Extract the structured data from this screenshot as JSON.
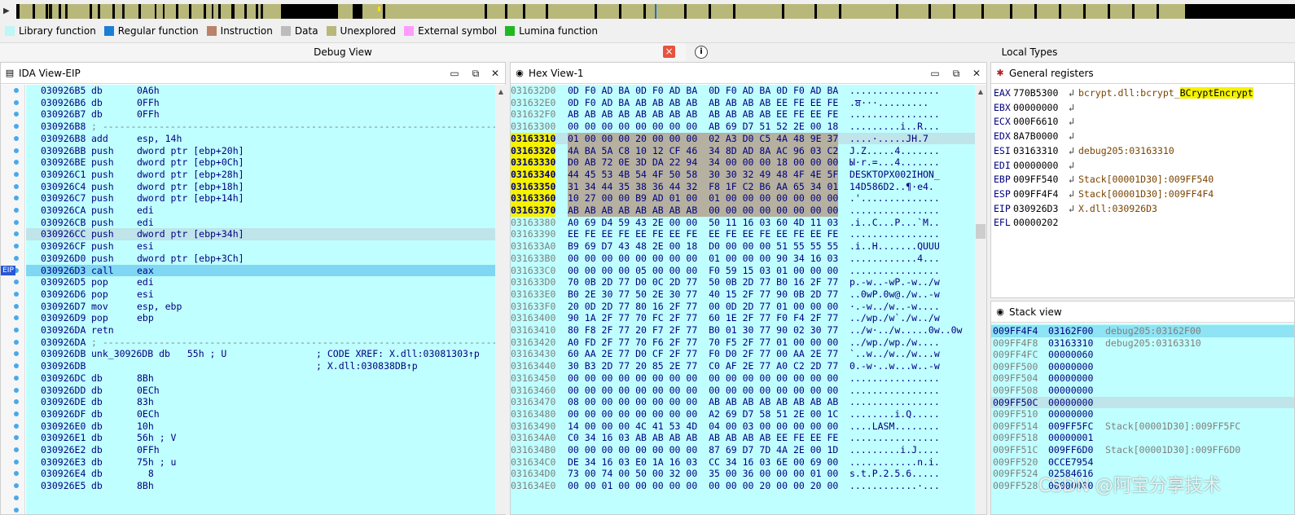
{
  "legend": [
    {
      "label": "Library function",
      "color": "#bff6f6"
    },
    {
      "label": "Regular function",
      "color": "#1a7fd4"
    },
    {
      "label": "Instruction",
      "color": "#b9826a"
    },
    {
      "label": "Data",
      "color": "#bcbcbc"
    },
    {
      "label": "Unexplored",
      "color": "#b8b87a"
    },
    {
      "label": "External symbol",
      "color": "#ff9cff"
    },
    {
      "label": "Lumina function",
      "color": "#22b822"
    }
  ],
  "tabs": {
    "debug_view": "Debug View",
    "local_types": "Local Types"
  },
  "ida": {
    "title": "IDA View-EIP",
    "eip_flag": "EIP",
    "lines": [
      {
        "addr": "030926B5",
        "mn": "db",
        "op": "0A6h"
      },
      {
        "addr": "030926B6",
        "mn": "db",
        "op": "0FFh"
      },
      {
        "addr": "030926B7",
        "mn": "db",
        "op": "0FFh"
      },
      {
        "addr": "030926B8",
        "mn": "; -------------------------------------------------------------------------",
        "op": ""
      },
      {
        "addr": "030926B8",
        "mn": "add",
        "op": "esp, 14h"
      },
      {
        "addr": "030926BB",
        "mn": "push",
        "op": "dword ptr [ebp+20h]"
      },
      {
        "addr": "030926BE",
        "mn": "push",
        "op": "dword ptr [ebp+0Ch]"
      },
      {
        "addr": "030926C1",
        "mn": "push",
        "op": "dword ptr [ebp+28h]"
      },
      {
        "addr": "030926C4",
        "mn": "push",
        "op": "dword ptr [ebp+18h]"
      },
      {
        "addr": "030926C7",
        "mn": "push",
        "op": "dword ptr [ebp+14h]"
      },
      {
        "addr": "030926CA",
        "mn": "push",
        "op": "edi"
      },
      {
        "addr": "030926CB",
        "mn": "push",
        "op": "edi"
      },
      {
        "addr": "030926CC",
        "mn": "push",
        "op": "dword ptr [ebp+34h]"
      },
      {
        "addr": "030926CF",
        "mn": "push",
        "op": "esi"
      },
      {
        "addr": "030926D0",
        "mn": "push",
        "op": "dword ptr [ebp+3Ch]"
      },
      {
        "addr": "030926D3",
        "mn": "call",
        "op": "eax"
      },
      {
        "addr": "030926D5",
        "mn": "pop",
        "op": "edi"
      },
      {
        "addr": "030926D6",
        "mn": "pop",
        "op": "esi"
      },
      {
        "addr": "030926D7",
        "mn": "mov",
        "op": "esp, ebp"
      },
      {
        "addr": "030926D9",
        "mn": "pop",
        "op": "ebp"
      },
      {
        "addr": "030926DA",
        "mn": "retn",
        "op": ""
      },
      {
        "addr": "030926DA",
        "mn": "; -------------------------------------------------------------------------",
        "op": ""
      },
      {
        "addr": "030926DB",
        "mn": "unk_30926DB db",
        "op": "  55h ; U",
        "xref": "; CODE XREF: X.dll:03081303↑p"
      },
      {
        "addr": "030926DB",
        "mn": "",
        "op": "",
        "xref": "; X.dll:030838DB↑p"
      },
      {
        "addr": "030926DC",
        "mn": "db",
        "op": "8Bh"
      },
      {
        "addr": "030926DD",
        "mn": "db",
        "op": "0ECh"
      },
      {
        "addr": "030926DE",
        "mn": "db",
        "op": "83h"
      },
      {
        "addr": "030926DF",
        "mn": "db",
        "op": "0ECh"
      },
      {
        "addr": "030926E0",
        "mn": "db",
        "op": "10h"
      },
      {
        "addr": "030926E1",
        "mn": "db",
        "op": "56h ; V"
      },
      {
        "addr": "030926E2",
        "mn": "db",
        "op": "0FFh"
      },
      {
        "addr": "030926E3",
        "mn": "db",
        "op": "75h ; u"
      },
      {
        "addr": "030926E4",
        "mn": "db",
        "op": "  8"
      },
      {
        "addr": "030926E5",
        "mn": "db",
        "op": "8Bh"
      }
    ]
  },
  "hex": {
    "title": "Hex View-1",
    "rows": [
      {
        "a": "031632D0",
        "b": "0D F0 AD BA 0D F0 AD BA  0D F0 AD BA 0D F0 AD BA",
        "x": "................"
      },
      {
        "a": "031632E0",
        "b": "0D F0 AD BA AB AB AB AB  AB AB AB AB EE FE EE FE",
        "x": ".ਬ···........."
      },
      {
        "a": "031632F0",
        "b": "AB AB AB AB AB AB AB AB  AB AB AB AB EE FE EE FE",
        "x": "................"
      },
      {
        "a": "03163300",
        "b": "00 00 00 00 00 00 00 00  AB 69 D7 51 52 2E 00 18",
        "x": ".........i..R..."
      },
      {
        "a": "03163310",
        "b": "01 00 00 00 20 00 00 00  02 A3 D0 C5 4A 48 9E 37",
        "x": "....·.....JH.7"
      },
      {
        "a": "03163320",
        "b": "4A BA 5A C8 10 12 CF 46  34 8D AD 8A AC 96 03 C2",
        "x": "J.Z.....4......."
      },
      {
        "a": "03163330",
        "b": "D0 AB 72 0E 3D DA 22 94  34 00 00 00 18 00 00 00",
        "x": "Ы·r.=...4......."
      },
      {
        "a": "03163340",
        "b": "44 45 53 4B 54 4F 50 58  30 30 32 49 48 4F 4E 5F",
        "x": "DESKTOPX002IHON_"
      },
      {
        "a": "03163350",
        "b": "31 34 44 35 38 36 44 32  F8 1F C2 B6 AA 65 34 01",
        "x": "14D586D2..¶·e4."
      },
      {
        "a": "03163360",
        "b": "10 27 00 00 B9 AD 01 00  01 00 00 00 00 00 00 00",
        "x": ".'.............."
      },
      {
        "a": "03163370",
        "b": "AB AB AB AB AB AB AB AB  00 00 00 00 00 00 00 00",
        "x": "................"
      },
      {
        "a": "03163380",
        "b": "A0 69 D4 59 43 2E 00 00  50 11 16 03 60 4D 11 03",
        "x": ".i..C...P...`M.."
      },
      {
        "a": "03163390",
        "b": "EE FE EE FE EE FE EE FE  EE FE EE FE EE FE EE FE",
        "x": "................"
      },
      {
        "a": "031633A0",
        "b": "B9 69 D7 43 48 2E 00 18  D0 00 00 00 51 55 55 55",
        "x": ".i..H.......QUUU"
      },
      {
        "a": "031633B0",
        "b": "00 00 00 00 00 00 00 00  01 00 00 00 90 34 16 03",
        "x": "............4..."
      },
      {
        "a": "031633C0",
        "b": "00 00 00 00 05 00 00 00  F0 59 15 03 01 00 00 00",
        "x": "................"
      },
      {
        "a": "031633D0",
        "b": "70 0B 2D 77 D0 0C 2D 77  50 0B 2D 77 B0 16 2F 77",
        "x": "p.-w..-wP.-w../w"
      },
      {
        "a": "031633E0",
        "b": "B0 2E 30 77 50 2E 30 77  40 15 2F 77 90 0B 2D 77",
        "x": "..0wP.0w@./w..-w"
      },
      {
        "a": "031633F0",
        "b": "20 0D 2D 77 80 16 2F 77  00 0D 2D 77 01 00 00 00",
        "x": "·.-w../w..-w...."
      },
      {
        "a": "03163400",
        "b": "90 1A 2F 77 70 FC 2F 77  60 1E 2F 77 F0 F4 2F 77",
        "x": "../wp./w`./w../w"
      },
      {
        "a": "03163410",
        "b": "80 F8 2F 77 20 F7 2F 77  B0 01 30 77 90 02 30 77",
        "x": "../w·../w.....0w..0w"
      },
      {
        "a": "03163420",
        "b": "A0 FD 2F 77 70 F6 2F 77  70 F5 2F 77 01 00 00 00",
        "x": "../wp./wp./w...."
      },
      {
        "a": "03163430",
        "b": "60 AA 2E 77 D0 CF 2F 77  F0 D0 2F 77 00 AA 2E 77",
        "x": "`..w../w../w...w"
      },
      {
        "a": "03163440",
        "b": "30 B3 2D 77 20 85 2E 77  C0 AF 2E 77 A0 C2 2D 77",
        "x": "0.-w·..w...w..-w"
      },
      {
        "a": "03163450",
        "b": "00 00 00 00 00 00 00 00  00 00 00 00 00 00 00 00",
        "x": "................"
      },
      {
        "a": "03163460",
        "b": "00 00 00 00 00 00 00 00  00 00 00 00 00 00 00 00",
        "x": "................"
      },
      {
        "a": "03163470",
        "b": "08 00 00 00 00 00 00 00  AB AB AB AB AB AB AB AB",
        "x": "................"
      },
      {
        "a": "03163480",
        "b": "00 00 00 00 00 00 00 00  A2 69 D7 58 51 2E 00 1C",
        "x": "........i.Q....."
      },
      {
        "a": "03163490",
        "b": "14 00 00 00 4C 41 53 4D  04 00 03 00 00 00 00 00",
        "x": "....LASM........"
      },
      {
        "a": "031634A0",
        "b": "C0 34 16 03 AB AB AB AB  AB AB AB AB EE FE EE FE",
        "x": "................"
      },
      {
        "a": "031634B0",
        "b": "00 00 00 00 00 00 00 00  87 69 D7 7D 4A 2E 00 1D",
        "x": ".........i.J...."
      },
      {
        "a": "031634C0",
        "b": "DE 34 16 03 E0 1A 16 03  CC 34 16 03 6E 00 69 00",
        "x": "............n.i."
      },
      {
        "a": "031634D0",
        "b": "73 00 74 00 50 00 32 00  35 00 36 00 00 00 01 00",
        "x": "s.t.P.2.5.6....."
      },
      {
        "a": "031634E0",
        "b": "00 00 01 00 00 00 00 00  00 00 00 20 00 00 20 00",
        "x": "............·..."
      }
    ]
  },
  "registers": {
    "title": "General registers",
    "items": [
      {
        "name": "EAX",
        "value": "770B5300",
        "desc_prefix": "bcrypt.dll:bcrypt_",
        "desc_sym": "BCryptEncrypt"
      },
      {
        "name": "EBX",
        "value": "00000000",
        "desc_prefix": "",
        "desc_sym": ""
      },
      {
        "name": "ECX",
        "value": "000F6610",
        "desc_prefix": "",
        "desc_sym": ""
      },
      {
        "name": "EDX",
        "value": "8A7B0000",
        "desc_prefix": "",
        "desc_sym": ""
      },
      {
        "name": "ESI",
        "value": "03163310",
        "desc_prefix": "debug205:03163310",
        "desc_sym": ""
      },
      {
        "name": "EDI",
        "value": "00000000",
        "desc_prefix": "",
        "desc_sym": ""
      },
      {
        "name": "EBP",
        "value": "009FF540",
        "desc_prefix": "Stack[00001D30]:009FF540",
        "desc_sym": ""
      },
      {
        "name": "ESP",
        "value": "009FF4F4",
        "desc_prefix": "Stack[00001D30]:009FF4F4",
        "desc_sym": ""
      },
      {
        "name": "EIP",
        "value": "030926D3",
        "desc_prefix": "X.dll:030926D3",
        "desc_sym": ""
      },
      {
        "name": "EFL",
        "value": "00000202",
        "desc_prefix": "",
        "desc_sym": ""
      }
    ]
  },
  "stack": {
    "title": "Stack view",
    "rows": [
      {
        "a": "009FF4F4",
        "v": "03162F00",
        "d": "debug205:03162F00"
      },
      {
        "a": "009FF4F8",
        "v": "03163310",
        "d": "debug205:03163310"
      },
      {
        "a": "009FF4FC",
        "v": "00000060",
        "d": ""
      },
      {
        "a": "009FF500",
        "v": "00000000",
        "d": ""
      },
      {
        "a": "009FF504",
        "v": "00000000",
        "d": ""
      },
      {
        "a": "009FF508",
        "v": "00000000",
        "d": ""
      },
      {
        "a": "009FF50C",
        "v": "00000000",
        "d": ""
      },
      {
        "a": "009FF510",
        "v": "00000000",
        "d": ""
      },
      {
        "a": "009FF514",
        "v": "009FF5FC",
        "d": "Stack[00001D30]:009FF5FC"
      },
      {
        "a": "009FF518",
        "v": "00000001",
        "d": ""
      },
      {
        "a": "009FF51C",
        "v": "009FF6D0",
        "d": "Stack[00001D30]:009FF6D0"
      },
      {
        "a": "009FF520",
        "v": "0CCE7954",
        "d": ""
      },
      {
        "a": "009FF524",
        "v": "02584616",
        "d": ""
      },
      {
        "a": "009FF528",
        "v": "00000000",
        "d": ""
      }
    ]
  },
  "watermark": "CSDN @阿宝分享技术"
}
